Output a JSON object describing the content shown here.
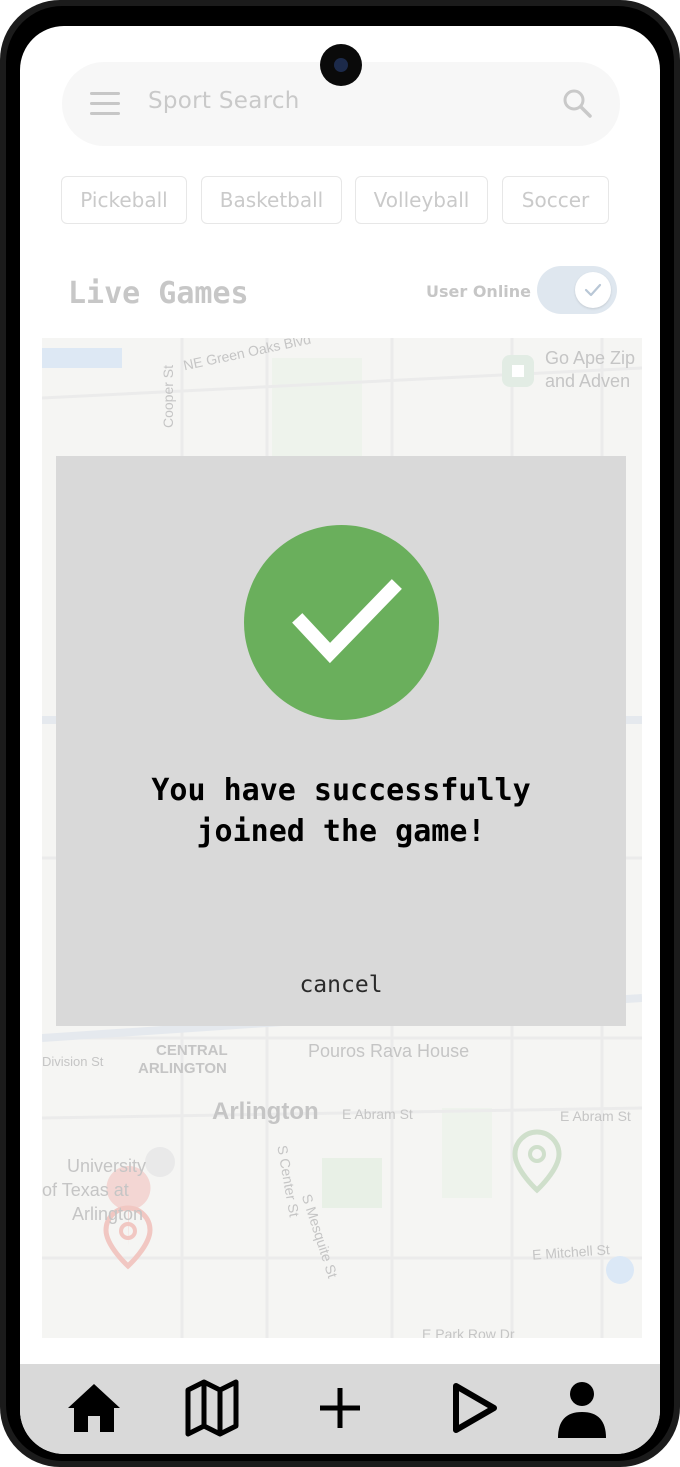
{
  "search": {
    "placeholder": "Sport Search"
  },
  "chips": [
    {
      "label": "Pickeball"
    },
    {
      "label": "Basketball"
    },
    {
      "label": "Volleyball"
    },
    {
      "label": "Soccer"
    }
  ],
  "live_games": {
    "title": "Live Games",
    "online_label": "User Online",
    "online_toggle_on": true
  },
  "map": {
    "labels": [
      "NE Green Oaks Blvd",
      "Cooper St",
      "Go Ape Zip",
      "and Adven",
      "CENTRAL",
      "ARLINGTON",
      "Division St",
      "Pouros Rava House",
      "Arlington",
      "E Abram St",
      "E Abram St",
      "University",
      "of Texas at",
      "Arlington",
      "S Center St",
      "S Mesquite St",
      "E Mitchell St",
      "E Park Row Dr",
      "St"
    ]
  },
  "modal": {
    "message": "You have successfully joined the game!",
    "line1": "You have successfully",
    "line2": "joined the game!",
    "cancel_label": "cancel",
    "success_color": "#6aaf5c"
  },
  "nav": {
    "items": [
      {
        "icon": "home-icon"
      },
      {
        "icon": "map-icon"
      },
      {
        "icon": "plus-icon"
      },
      {
        "icon": "play-icon"
      },
      {
        "icon": "profile-icon"
      }
    ]
  }
}
